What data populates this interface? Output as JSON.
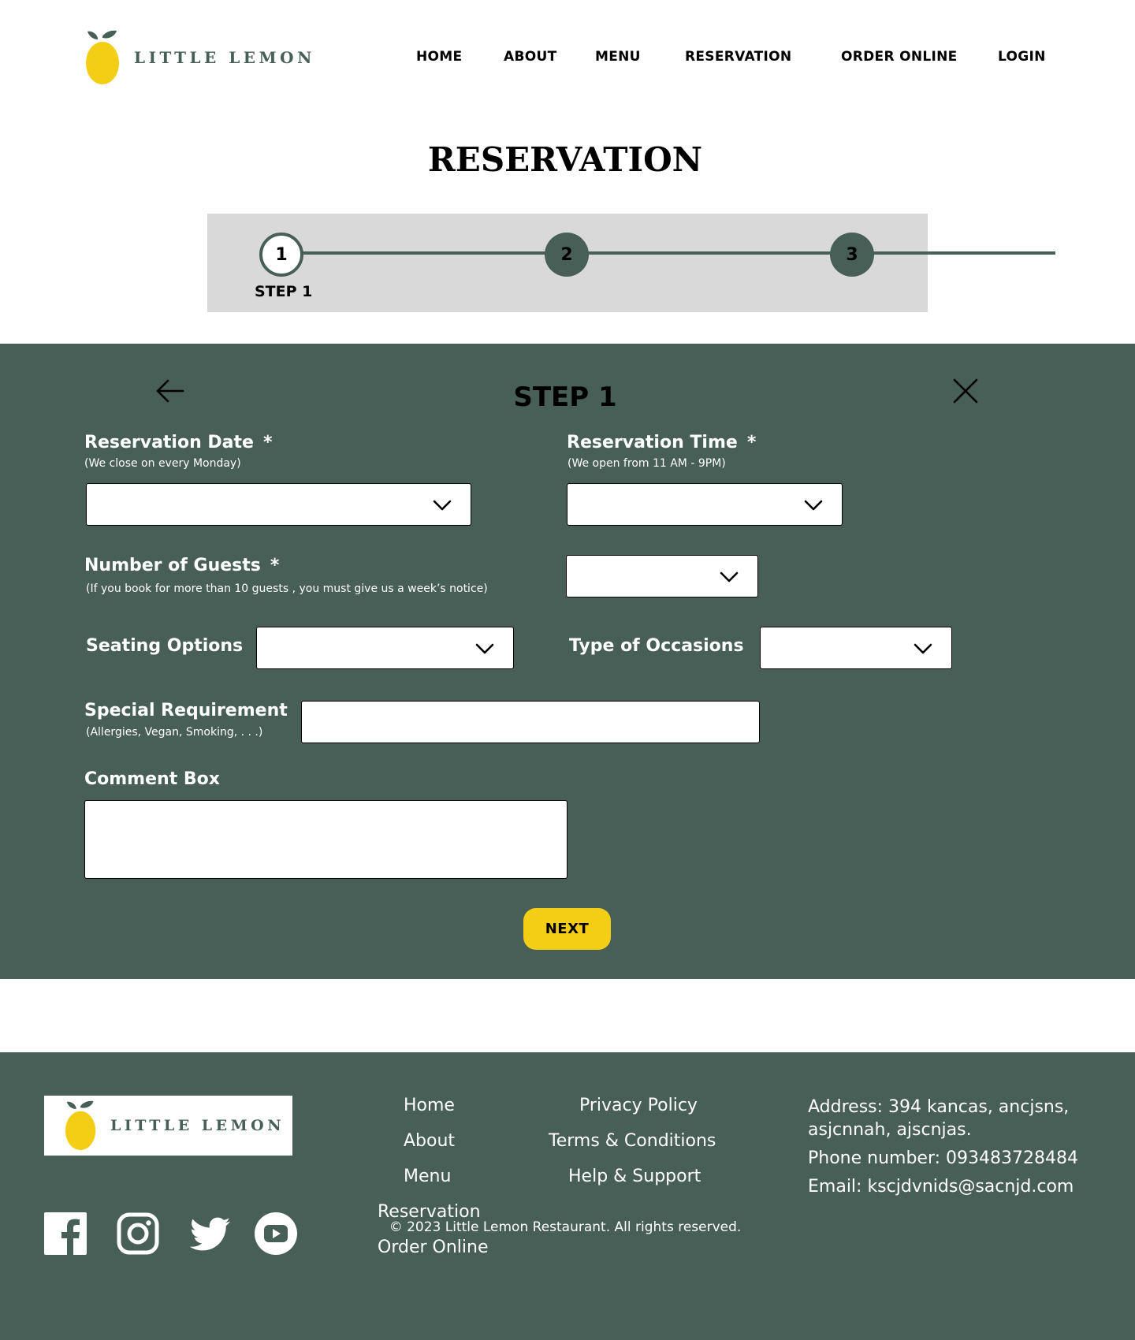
{
  "brand": {
    "name": "LITTLE LEMON"
  },
  "nav": {
    "home": "HOME",
    "about": "ABOUT",
    "menu": "MENU",
    "reservation": "RESERVATION",
    "order_online": "ORDER ONLINE",
    "login": "LOGIN"
  },
  "page": {
    "title": "RESERVATION"
  },
  "stepper": {
    "steps": [
      "1",
      "2",
      "3"
    ],
    "current_step": 1,
    "current_label": "STEP 1"
  },
  "form": {
    "title": "STEP 1",
    "reservation_date": {
      "label": "Reservation Date",
      "required_mark": "*",
      "hint": "(We close on every Monday)",
      "value": ""
    },
    "reservation_time": {
      "label": "Reservation Time",
      "required_mark": "*",
      "hint": "(We open from 11 AM - 9PM)",
      "value": ""
    },
    "guests": {
      "label": "Number of Guests",
      "required_mark": "*",
      "hint": "(If you book for more than 10 guests , you must give us a week’s notice)",
      "value": ""
    },
    "seating": {
      "label": "Seating Options",
      "value": ""
    },
    "occasion": {
      "label": "Type of Occasions",
      "value": ""
    },
    "special": {
      "label": "Special Requirement",
      "hint": "(Allergies, Vegan, Smoking, . . .)",
      "value": ""
    },
    "comment": {
      "label": "Comment Box",
      "value": ""
    },
    "next_label": "NEXT"
  },
  "footer": {
    "nav_links": [
      "Home",
      "About",
      "Menu",
      "Reservation",
      "Order Online"
    ],
    "policy_links": [
      "Privacy Policy",
      "Terms & Conditions",
      "Help & Support"
    ],
    "address": "Address: 394 kancas, ancjsns, asjcnnah, ajscnjas.",
    "phone": "Phone number: 093483728484",
    "email": "Email: kscjdvnids@sacnjd.com",
    "social_icons": [
      "facebook-icon",
      "instagram-icon",
      "twitter-icon",
      "youtube-icon"
    ],
    "copyright": "© 2023 Little Lemon Restaurant. All rights reserved."
  },
  "colors": {
    "primary_green": "#485f58",
    "accent_yellow": "#f4ce14",
    "stepper_bg": "#d9d9d9",
    "white": "#ffffff"
  }
}
